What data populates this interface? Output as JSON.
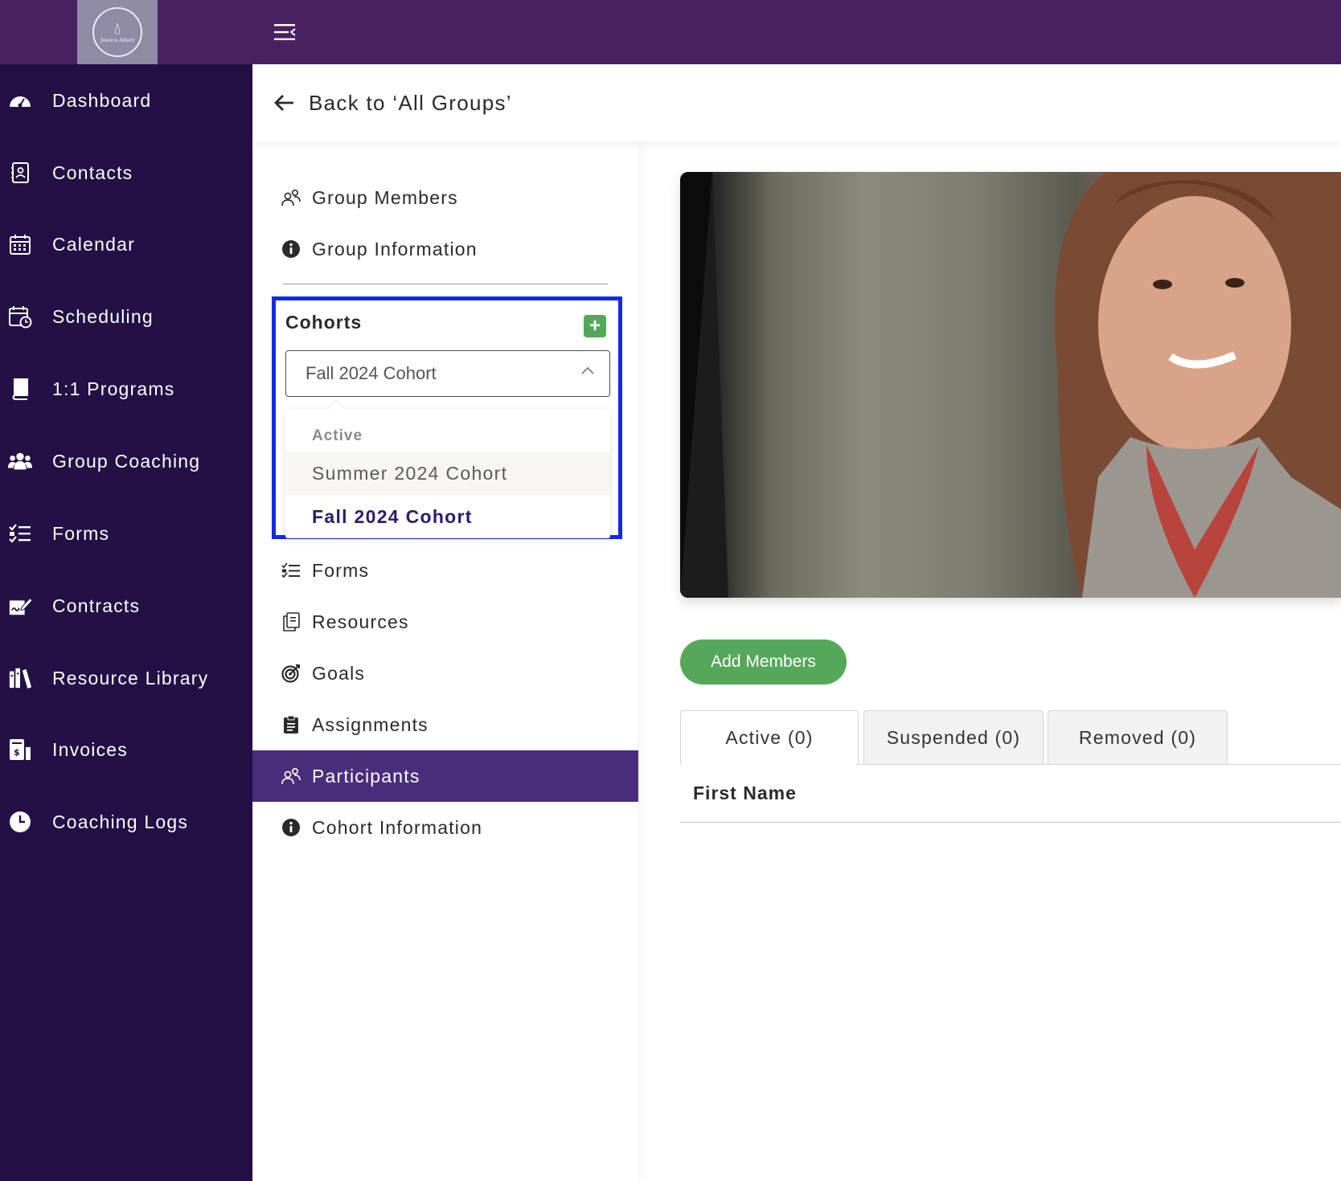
{
  "brand": {
    "logo_text": "Jessica Albert",
    "topbar_color": "#4a2160",
    "sidebar_color": "#221046",
    "accent_green": "#55a85a",
    "active_purple": "#4b2d7d",
    "highlight_border": "#1428e6"
  },
  "sidebar": {
    "items": [
      {
        "label": "Dashboard",
        "icon": "dashboard-icon"
      },
      {
        "label": "Contacts",
        "icon": "contacts-icon"
      },
      {
        "label": "Calendar",
        "icon": "calendar-icon"
      },
      {
        "label": "Scheduling",
        "icon": "scheduling-icon"
      },
      {
        "label": "1:1 Programs",
        "icon": "book-icon"
      },
      {
        "label": "Group Coaching",
        "icon": "users-icon"
      },
      {
        "label": "Forms",
        "icon": "forms-icon"
      },
      {
        "label": "Contracts",
        "icon": "contract-icon"
      },
      {
        "label": "Resource Library",
        "icon": "library-icon"
      },
      {
        "label": "Invoices",
        "icon": "invoice-icon"
      },
      {
        "label": "Coaching Logs",
        "icon": "clock-icon"
      }
    ]
  },
  "header": {
    "back_label": "Back to ‘All Groups’"
  },
  "group_menu": {
    "items": [
      {
        "label": "Group Members",
        "icon": "members-icon"
      },
      {
        "label": "Group Information",
        "icon": "info-icon"
      }
    ]
  },
  "cohorts": {
    "title": "Cohorts",
    "add_label": "+",
    "selected": "Fall 2024 Cohort",
    "dropdown": {
      "group_label": "Active",
      "options": [
        "Summer 2024 Cohort",
        "Fall 2024 Cohort"
      ],
      "selected_option": "Fall 2024 Cohort"
    }
  },
  "cohort_menu": {
    "items": [
      {
        "label": "Forms",
        "icon": "forms-icon"
      },
      {
        "label": "Resources",
        "icon": "resources-icon"
      },
      {
        "label": "Goals",
        "icon": "target-icon"
      },
      {
        "label": "Assignments",
        "icon": "clipboard-icon"
      },
      {
        "label": "Participants",
        "icon": "members-icon",
        "active": true
      },
      {
        "label": "Cohort Information",
        "icon": "info-icon"
      }
    ]
  },
  "main": {
    "add_members_label": "Add Members",
    "tabs": [
      {
        "label": "Active (0)",
        "active": true
      },
      {
        "label": "Suspended (0)"
      },
      {
        "label": "Removed (0)"
      }
    ],
    "table": {
      "columns": [
        "First Name"
      ]
    }
  }
}
